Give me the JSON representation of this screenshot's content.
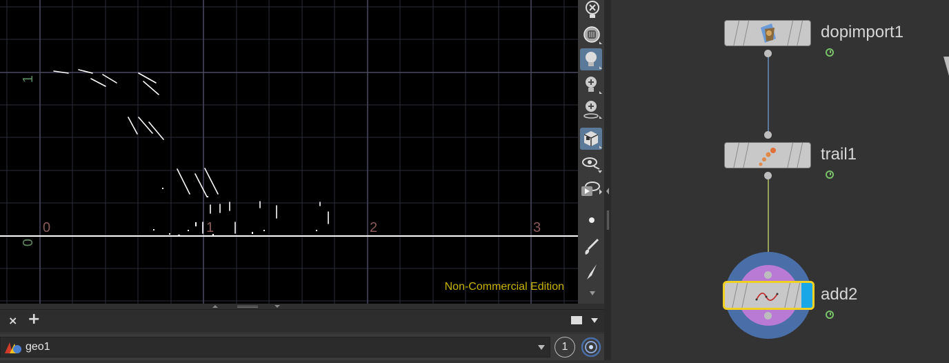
{
  "viewport": {
    "x_tick_labels": [
      "0",
      "1",
      "2",
      "3"
    ],
    "y_tick_labels": [
      "1",
      "0"
    ],
    "watermark": "Non-Commercial Edition"
  },
  "viewport_toolbar": {
    "icons": [
      "close-light-icon",
      "headlight-icon",
      "light-bulb-icon",
      "add-light-icon",
      "add-light-pin-icon",
      "display-options-icon",
      "visibility-icon",
      "view-render-icon",
      "point-icon",
      "brush-icon",
      "pen-icon",
      "more-icon"
    ]
  },
  "tab_bar": {
    "close_label": "×",
    "add_label": "+"
  },
  "path_bar": {
    "context": "geo1",
    "counter": "1"
  },
  "network": {
    "nodes": [
      {
        "name": "dopimport1",
        "icon": "dopimport-icon"
      },
      {
        "name": "trail1",
        "icon": "trail-icon"
      },
      {
        "name": "add2",
        "icon": "add-curve-icon",
        "selected": true,
        "display_flag": true
      }
    ],
    "wire_colors": {
      "upper": "#6b8fbf",
      "lower": "#b8c46b"
    },
    "highlight": {
      "outer": "#4a6ea8",
      "inner": "#b97ad6"
    }
  }
}
